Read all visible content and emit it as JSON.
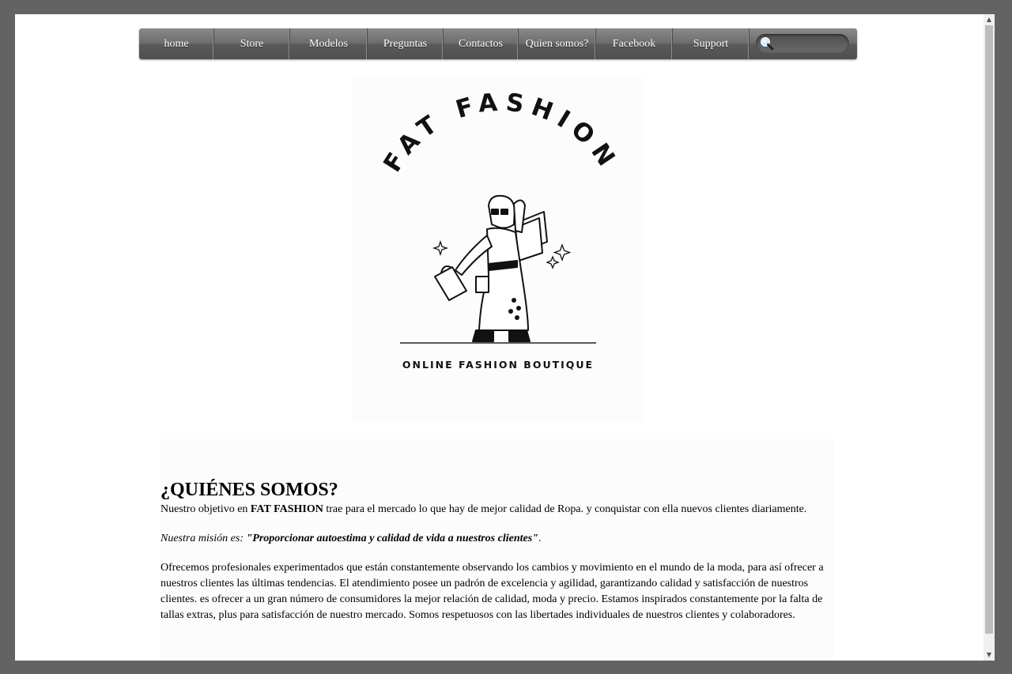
{
  "nav": {
    "items": [
      "home",
      "Store",
      "Modelos",
      "Preguntas",
      "Contactos",
      "Quien somos?",
      "Facebook",
      "Support"
    ],
    "search_placeholder": "",
    "search_icon": "search-icon"
  },
  "logo": {
    "brand": "FAT FASHION",
    "tagline": "ONLINE FASHION BOUTIQUE"
  },
  "about": {
    "title": "¿QUIÉNES SOMOS?",
    "p1_before": "Nuestro objetivo en ",
    "p1_brand": "FAT FASHION",
    "p1_after": " trae para el mercado lo que hay de mejor calidad de Ropa. y conquistar con ella nuevos clientes diariamente.",
    "mission_label": "Nuestra misión es: ",
    "mission_quote": "\"Proporcionar autoestima y calidad de vida a nuestros clientes\"",
    "mission_end": ".",
    "p3": "Ofrecemos profesionales experimentados que están constantemente observando los cambios y movimiento en el mundo de la moda, para así ofrecer a nuestros clientes las últimas tendencias. El atendimiento posee un padrón de excelencia y agilidad, garantizando calidad y satisfacción de nuestros clientes. es ofrecer a un gran número de consumidores la mejor relación de calidad, moda y precio. Estamos inspirados constantemente por la falta de tallas extras, plus para satisfacción de nuestro mercado. Somos respetuosos con las libertades individuales de nuestros clientes y colaboradores."
  }
}
